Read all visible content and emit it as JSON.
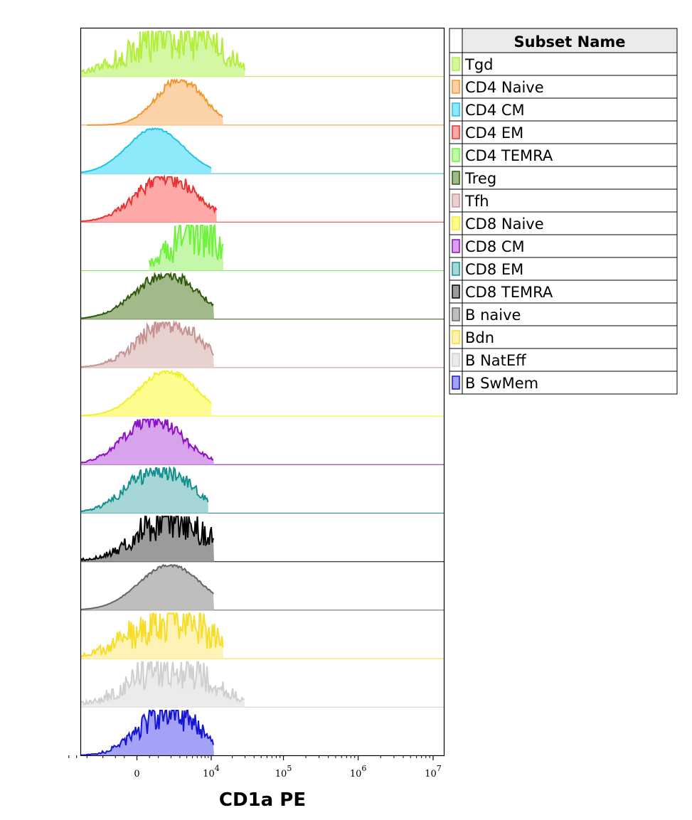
{
  "chart_data": {
    "type": "area",
    "plot": "stacked histogram overlay (ridgeline)",
    "xlabel": "CD1a PE",
    "xscale": "biexponential",
    "x_ticks": [
      {
        "value": 0,
        "base": "0",
        "exp": ""
      },
      {
        "value": 10000,
        "base": "10",
        "exp": "4"
      },
      {
        "value": 100000,
        "base": "10",
        "exp": "5"
      },
      {
        "value": 1000000,
        "base": "10",
        "exp": "6"
      },
      {
        "value": 10000000,
        "base": "10",
        "exp": "7"
      }
    ],
    "grid": false,
    "legend": {
      "title": "Subset Name",
      "placement": "right"
    },
    "series": [
      {
        "name": "Tgd",
        "fill": "#d3f7a3",
        "stroke": "#b4ee3c",
        "peak": 2500,
        "spread": 0.95,
        "range": [
          -5000,
          30000
        ],
        "noise": 0.75,
        "seed": 3
      },
      {
        "name": "CD4 Naive",
        "fill": "#fcd2a8",
        "stroke": "#f2962e",
        "peak": 3000,
        "spread": 0.55,
        "range": [
          -4000,
          15000
        ],
        "noise": 0.12,
        "seed": 7
      },
      {
        "name": "CD4 CM",
        "fill": "#8ee9fa",
        "stroke": "#21c3e3",
        "peak": 800,
        "spread": 0.65,
        "range": [
          -9000,
          10000
        ],
        "noise": 0.03,
        "seed": 11
      },
      {
        "name": "CD4 EM",
        "fill": "#ffa8a8",
        "stroke": "#e83232",
        "peak": 1600,
        "spread": 0.7,
        "range": [
          -8000,
          12000
        ],
        "noise": 0.22,
        "seed": 13
      },
      {
        "name": "CD4 TEMRA",
        "fill": "#c4f7ac",
        "stroke": "#6ff23a",
        "peak": 5500,
        "spread": 0.5,
        "range": [
          500,
          15000
        ],
        "noise": 0.9,
        "seed": 17
      },
      {
        "name": "Treg",
        "fill": "#a2b98a",
        "stroke": "#2f5a0c",
        "peak": 1600,
        "spread": 0.72,
        "range": [
          -9000,
          11000
        ],
        "noise": 0.15,
        "seed": 19
      },
      {
        "name": "Tfh",
        "fill": "#e7d2d0",
        "stroke": "#c59391",
        "peak": 1900,
        "spread": 0.72,
        "range": [
          -9000,
          11000
        ],
        "noise": 0.3,
        "seed": 23
      },
      {
        "name": "CD8 Naive",
        "fill": "#fdfc8f",
        "stroke": "#f2ef2e",
        "peak": 1700,
        "spread": 0.66,
        "range": [
          -6000,
          10000
        ],
        "noise": 0.08,
        "seed": 29
      },
      {
        "name": "CD8 CM",
        "fill": "#d8a2ec",
        "stroke": "#8b12c4",
        "peak": 700,
        "spread": 0.68,
        "range": [
          -9000,
          11000
        ],
        "noise": 0.2,
        "seed": 31
      },
      {
        "name": "CD8 EM",
        "fill": "#a6d7d6",
        "stroke": "#13908f",
        "peak": 1100,
        "spread": 0.72,
        "range": [
          -8000,
          9000
        ],
        "noise": 0.28,
        "seed": 37
      },
      {
        "name": "CD8 TEMRA",
        "fill": "#9b9b9b",
        "stroke": "#000000",
        "peak": 2200,
        "spread": 0.75,
        "range": [
          -7000,
          11000
        ],
        "noise": 0.6,
        "seed": 41
      },
      {
        "name": "B naive",
        "fill": "#bebebe",
        "stroke": "#666666",
        "peak": 1900,
        "spread": 0.72,
        "range": [
          -9000,
          11000
        ],
        "noise": 0.04,
        "seed": 43
      },
      {
        "name": "Bdn",
        "fill": "#fdf3b6",
        "stroke": "#f7dd28",
        "peak": 2000,
        "spread": 0.85,
        "range": [
          -8000,
          15000
        ],
        "noise": 0.8,
        "seed": 47
      },
      {
        "name": "B NatEff",
        "fill": "#ebebeb",
        "stroke": "#cfcfcf",
        "peak": 2000,
        "spread": 0.85,
        "range": [
          -9000,
          30000
        ],
        "noise": 0.7,
        "seed": 53
      },
      {
        "name": "B SwMem",
        "fill": "#a3a2f6",
        "stroke": "#1414d4",
        "peak": 1800,
        "spread": 0.68,
        "range": [
          -8000,
          11000
        ],
        "noise": 0.45,
        "seed": 59
      }
    ]
  }
}
